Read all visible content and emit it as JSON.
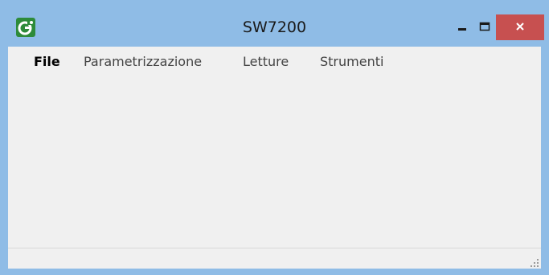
{
  "window": {
    "title": "SW7200",
    "app_icon": "gi-logo-icon",
    "controls": {
      "minimize": "minimize-icon",
      "maximize": "maximize-icon",
      "close": "close-icon"
    }
  },
  "menubar": {
    "items": [
      {
        "label": "File"
      },
      {
        "label": "Parametrizzazione"
      },
      {
        "label": "Letture"
      },
      {
        "label": "Strumenti"
      }
    ]
  },
  "colors": {
    "titlebar": "#8fbce6",
    "close_button": "#c75050",
    "client_background": "#f0f0f0"
  }
}
